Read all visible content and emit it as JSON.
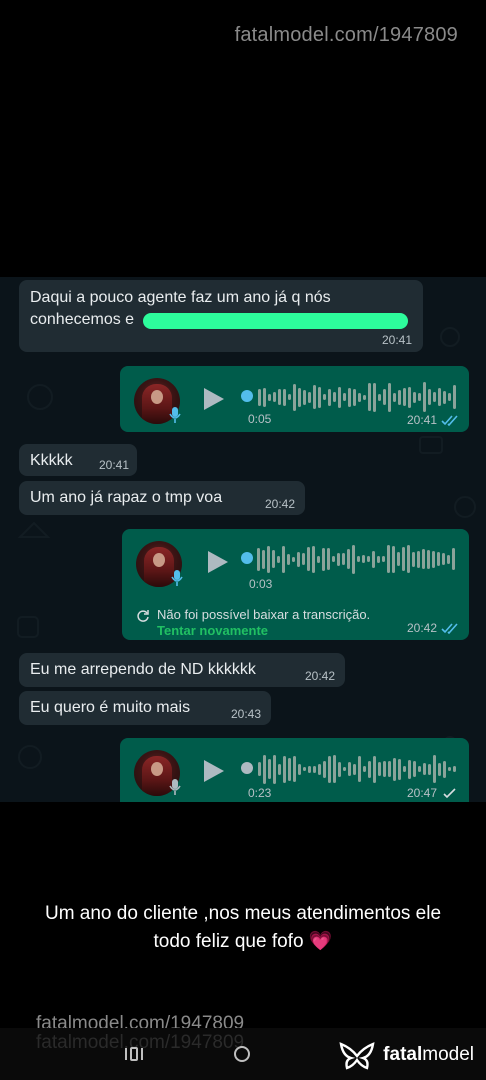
{
  "watermark": {
    "top": "fatalmodel.com/1947809",
    "bottom": "fatalmodel.com/1947809"
  },
  "messages": {
    "m1": {
      "text_line1": "Daqui a pouco agente faz um ano já q nós",
      "text_line2": "conhecemos e ",
      "time": "20:41"
    },
    "a1": {
      "duration": "0:05",
      "time": "20:41"
    },
    "m2": {
      "text": "Kkkkk",
      "time": "20:41"
    },
    "m3": {
      "text": "Um ano já rapaz o tmp voa",
      "time": "20:42"
    },
    "a2": {
      "duration": "0:03",
      "time": "20:42",
      "transcription_error": "Não foi possível baixar a transcrição.",
      "retry": "Tentar novamente"
    },
    "m4": {
      "text": "Eu me arrependo de ND kkkkkk",
      "time": "20:42"
    },
    "m5": {
      "text": "Eu quero é muito mais",
      "time": "20:43"
    },
    "a3": {
      "duration": "0:23",
      "time": "20:47"
    }
  },
  "caption": {
    "line1": "Um ano do cliente ,nos meus atendimentos ele",
    "line2": "todo feliz que fofo"
  },
  "logo": {
    "bold": "fatal",
    "light": "model"
  },
  "colors": {
    "chat_bg": "#0b141a",
    "incoming": "#202c33",
    "outgoing": "#005c4b",
    "accent_blue": "#53bdeb",
    "retry_green": "#21c063",
    "highlight": "#2dfc9c"
  },
  "icons": [
    "play-icon",
    "microphone-icon",
    "double-check-icon",
    "single-check-icon",
    "refresh-icon",
    "recents-icon",
    "home-icon",
    "fatalmodel-logo-icon",
    "heart-emoji"
  ]
}
